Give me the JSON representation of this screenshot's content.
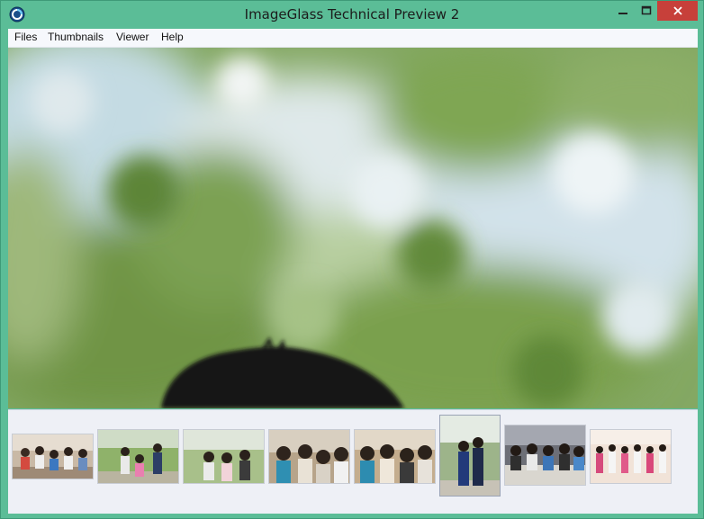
{
  "window": {
    "title": "ImageGlass Technical Preview 2",
    "accent_color": "#5bbd97",
    "close_color": "#c7403a"
  },
  "menu": {
    "items": [
      "Files",
      "Thumbnails",
      "Viewer",
      "Help"
    ]
  },
  "viewer": {
    "image_description_icon": "blurred-foliage-photo"
  },
  "thumbnails": {
    "count": 8,
    "selected_index": 5
  }
}
